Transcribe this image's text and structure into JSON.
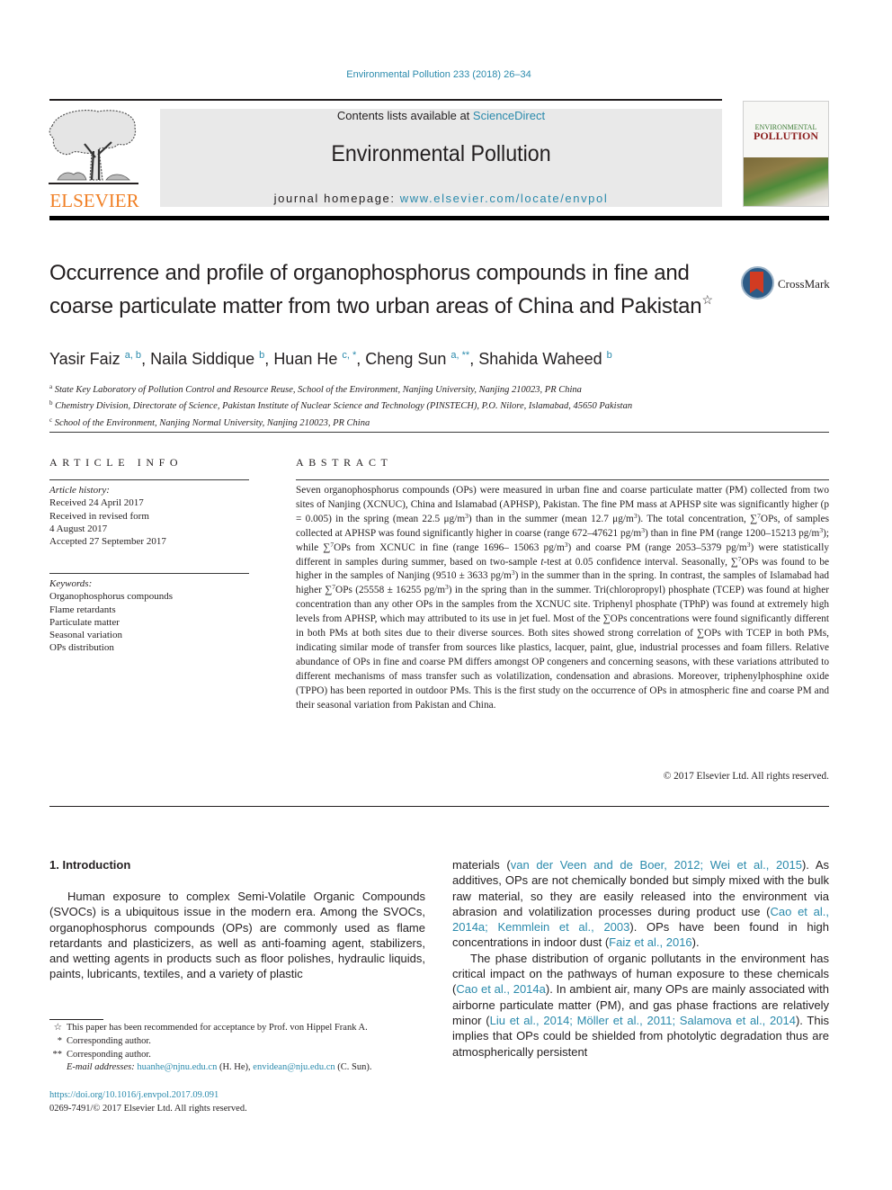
{
  "header": {
    "journal_ref": "Environmental Pollution 233 (2018) 26–34",
    "contents_prefix": "Contents lists available at ",
    "contents_link": "ScienceDirect",
    "journal_title": "Environmental Pollution",
    "homepage_prefix": "journal homepage: ",
    "homepage_link": "www.elsevier.com/locate/envpol",
    "publisher_logo_text": "ELSEVIER",
    "cover_line1": "ENVIRONMENTAL",
    "cover_line2": "POLLUTION"
  },
  "article": {
    "title": "Occurrence and profile of organophosphorus compounds in fine and coarse particulate matter from two urban areas of China and Pakistan",
    "title_mark": "☆",
    "crossmark_label": "CrossMark",
    "authors": [
      {
        "name": "Yasir Faiz",
        "marks": "a, b"
      },
      {
        "name": "Naila Siddique",
        "marks": "b"
      },
      {
        "name": "Huan He",
        "marks": "c, *"
      },
      {
        "name": "Cheng Sun",
        "marks": "a, **"
      },
      {
        "name": "Shahida Waheed",
        "marks": "b"
      }
    ],
    "affiliations": [
      {
        "mark": "a",
        "text": "State Key Laboratory of Pollution Control and Resource Reuse, School of the Environment, Nanjing University, Nanjing 210023, PR China"
      },
      {
        "mark": "b",
        "text": "Chemistry Division, Directorate of Science, Pakistan Institute of Nuclear Science and Technology (PINSTECH), P.O. Nilore, Islamabad, 45650 Pakistan"
      },
      {
        "mark": "c",
        "text": "School of the Environment, Nanjing Normal University, Nanjing 210023, PR China"
      }
    ]
  },
  "article_info": {
    "heading": "ARTICLE INFO",
    "history_label": "Article history:",
    "history": [
      "Received 24 April 2017",
      "Received in revised form",
      "4 August 2017",
      "Accepted 27 September 2017"
    ],
    "keywords_label": "Keywords:",
    "keywords": [
      "Organophosphorus compounds",
      "Flame retardants",
      "Particulate matter",
      "Seasonal variation",
      "OPs distribution"
    ]
  },
  "abstract": {
    "heading": "ABSTRACT",
    "parts": {
      "p1": "Seven organophosphorus compounds (OPs) were measured in urban fine and coarse particulate matter (PM) collected from two sites of Nanjing (XCNUC), China and Islamabad (APHSP), Pakistan. The fine PM mass at APHSP site was significantly higher (p = 0.005) in the spring (mean 22.5 μg/m",
      "p2": ") than in the summer (mean 12.7 μg/m",
      "p3": "). The total concentration, ∑",
      "p4": "OPs, of samples collected at APHSP was found significantly higher in coarse (range 672–47621 pg/m",
      "p5": ") than in fine PM (range 1200–15213 pg/m",
      "p6": "); while ∑",
      "p7": "OPs from XCNUC in fine (range 1696– 15063 pg/m",
      "p8": ") and coarse PM (range 2053–5379 pg/m",
      "p9": ") were statistically different in samples during summer, based on two-sample ",
      "p9i": "t",
      "p10": "-test at 0.05 confidence interval. Seasonally, ∑",
      "p11": "OPs was found to be higher in the samples of Nanjing (9510 ± 3633 pg/m",
      "p12": ") in the summer than in the spring. In contrast, the samples of Islamabad had higher ∑",
      "p13": "OPs (25558 ± 16255 pg/m",
      "p14": ") in the spring than in the summer. Tri(chloropropyl) phosphate (TCEP) was found at higher concentration than any other OPs in the samples from the XCNUC site. Triphenyl phosphate (TPhP) was found at extremely high levels from APHSP, which may attributed to its use in jet fuel. Most of the ∑OPs concentrations were found significantly different in both PMs at both sites due to their diverse sources. Both sites showed strong correlation of ∑OPs with TCEP in both PMs, indicating similar mode of transfer from sources like plastics, lacquer, paint, glue, industrial processes and foam fillers. Relative abundance of OPs in fine and coarse PM differs amongst OP congeners and concerning seasons, with these variations attributed to different mechanisms of mass transfer such as volatilization, condensation and abrasions. Moreover, triphenylphosphine oxide (TPPO) has been reported in outdoor PMs. This is the first study on the occurrence of OPs in atmospheric fine and coarse PM and their seasonal variation from Pakistan and China.",
      "sup3": "3",
      "sup7": "7"
    },
    "copyright": "© 2017 Elsevier Ltd. All rights reserved."
  },
  "introduction": {
    "heading": "1.  Introduction",
    "left_para": "Human exposure to complex Semi-Volatile Organic Compounds (SVOCs) is a ubiquitous issue in the modern era. Among the SVOCs, organophosphorus compounds (OPs) are commonly used as flame retardants and plasticizers, as well as anti-foaming agent, stabilizers, and wetting agents in products such as floor polishes, hydraulic liquids, paints, lubricants, textiles, and a variety of plastic",
    "right_para1": {
      "t1": "materials (",
      "c1": "van der Veen and de Boer, 2012; Wei et al., 2015",
      "t2": "). As additives, OPs are not chemically bonded but simply mixed with the bulk raw material, so they are easily released into the environment via abrasion and volatilization processes during product use (",
      "c2": "Cao et al., 2014a; Kemmlein et al., 2003",
      "t3": "). OPs have been found in high concentrations in indoor dust (",
      "c3": "Faiz et al., 2016",
      "t4": ")."
    },
    "right_para2": {
      "t1": "The phase distribution of organic pollutants in the environment has critical impact on the pathways of human exposure to these chemicals (",
      "c1": "Cao et al., 2014a",
      "t2": "). In ambient air, many OPs are mainly associated with airborne particulate matter (PM), and gas phase fractions are relatively minor (",
      "c2": "Liu et al., 2014; Möller et al., 2011; Salamova et al., 2014",
      "t3": "). This implies that OPs could be shielded from photolytic degradation thus are atmospherically persistent"
    }
  },
  "footnotes": {
    "items": [
      {
        "mark": "☆",
        "text": "This paper has been recommended for acceptance by Prof. von Hippel Frank A."
      },
      {
        "mark": "*",
        "text": "Corresponding author."
      },
      {
        "mark": "**",
        "text": "Corresponding author."
      }
    ],
    "email_label": "E-mail addresses:",
    "email1": "huanhe@njnu.edu.cn",
    "email1_owner": " (H. He), ",
    "email2": "envidean@nju.edu.cn",
    "email2_owner": " (C. Sun).",
    "doi": "https://doi.org/10.1016/j.envpol.2017.09.091",
    "issn": "0269-7491/© 2017 Elsevier Ltd. All rights reserved."
  }
}
